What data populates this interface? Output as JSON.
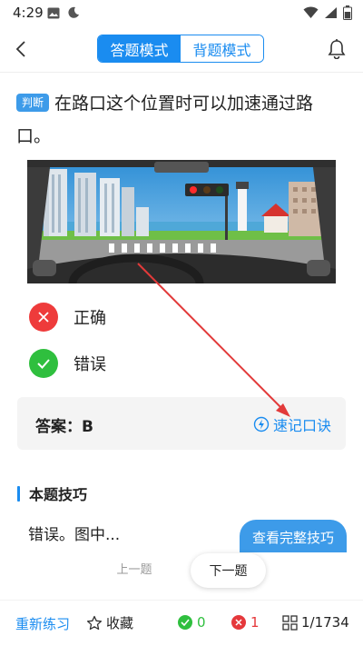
{
  "status_bar": {
    "time": "4:29"
  },
  "header": {
    "modes": [
      {
        "label": "答题模式",
        "active": true
      },
      {
        "label": "背题模式",
        "active": false
      }
    ]
  },
  "question": {
    "badge": "判断",
    "text": "在路口这个位置时可以加速通过路口。"
  },
  "options": [
    {
      "label": "正确",
      "icon": "close-icon",
      "color": "#ee3b3b"
    },
    {
      "label": "错误",
      "icon": "check-icon",
      "color": "#2fbf3e"
    }
  ],
  "answer": {
    "text": "答案：B",
    "mnemonic_label": "速记口诀"
  },
  "tips": {
    "title": "本题技巧",
    "text": "错误。图中...",
    "view_full_label": "查看完整技巧"
  },
  "nav": {
    "prev_label": "上一题",
    "next_label": "下一题"
  },
  "bottom_bar": {
    "practice_label": "重新练习",
    "favorite_label": "收藏",
    "correct_count": "0",
    "wrong_count": "1",
    "progress": "1/1734"
  },
  "colors": {
    "accent": "#1a8cf0",
    "correct": "#2fbf3e",
    "wrong": "#e5383b"
  }
}
